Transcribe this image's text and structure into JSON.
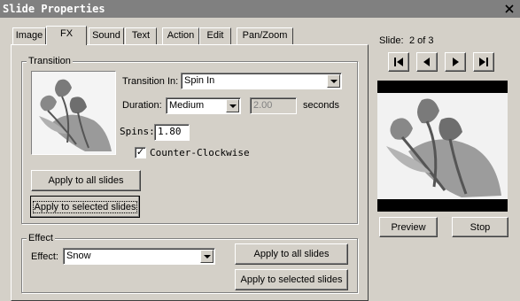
{
  "window": {
    "title": "Slide Properties",
    "close_icon": "close-icon"
  },
  "tabs": [
    {
      "label": "Image"
    },
    {
      "label": "FX"
    },
    {
      "label": "Sound"
    },
    {
      "label": "Text"
    },
    {
      "label": "Action"
    },
    {
      "label": "Edit"
    },
    {
      "label": "Pan/Zoom"
    }
  ],
  "transition": {
    "group_label": "Transition",
    "transition_in_label": "Transition In:",
    "transition_in_value": "Spin In",
    "duration_label": "Duration:",
    "duration_value": "Medium",
    "duration_seconds_value": "2.00",
    "seconds_label": "seconds",
    "spins_label": "Spins:",
    "spins_value": "1.80",
    "counter_clockwise_label": "Counter-Clockwise",
    "counter_clockwise_checked": "✓",
    "apply_all_label": "Apply to all slides",
    "apply_selected_label": "Apply to selected slides"
  },
  "effect": {
    "group_label": "Effect",
    "effect_label": "Effect:",
    "effect_value": "Snow",
    "apply_all_label": "Apply to all slides",
    "apply_selected_label": "Apply to selected slides"
  },
  "preview": {
    "slide_label": "Slide:",
    "slide_position": "2 of 3",
    "preview_label": "Preview",
    "stop_label": "Stop"
  },
  "colors": {
    "window_bg": "#d4d0c8",
    "titlebar": "#808080"
  }
}
